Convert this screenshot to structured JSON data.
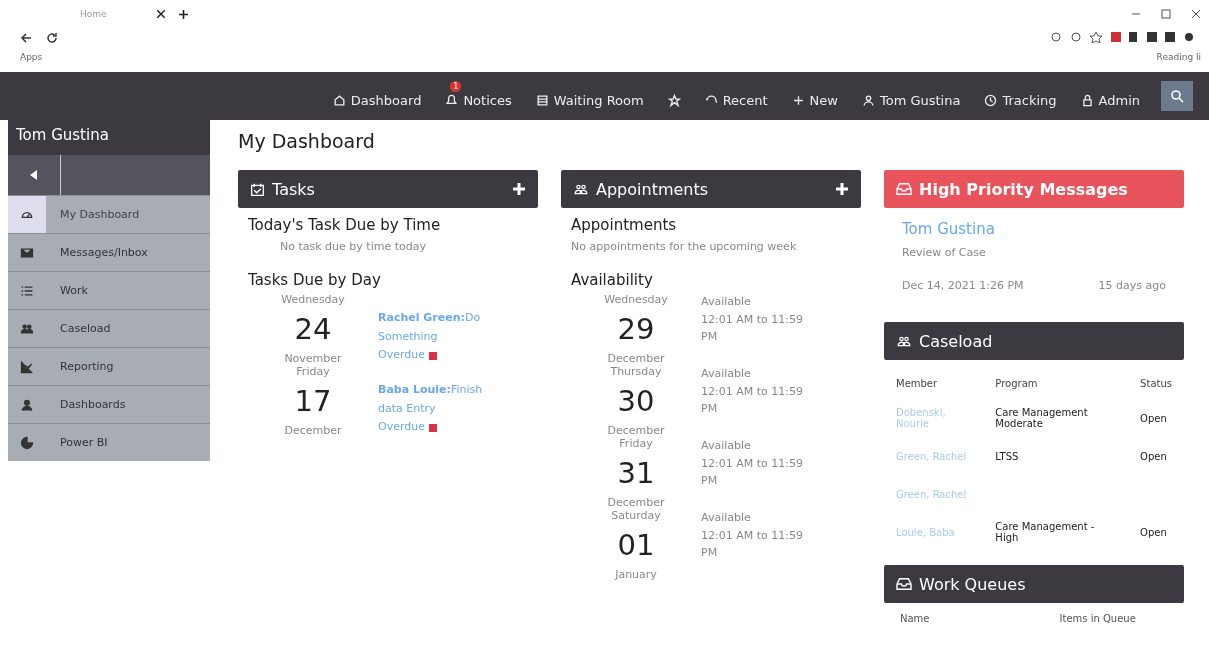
{
  "browser": {
    "tab_title": "Home",
    "bookmark": "Apps",
    "reading_list": "Reading li"
  },
  "topnav": [
    {
      "kind": "home",
      "label": "Dashboard"
    },
    {
      "kind": "bell",
      "label": "Notices",
      "badge": "1"
    },
    {
      "kind": "room",
      "label": "Waiting Room"
    },
    {
      "kind": "star"
    },
    {
      "kind": "recent",
      "label": "Recent"
    },
    {
      "kind": "plus",
      "label": "New"
    },
    {
      "kind": "user",
      "label": "Tom Gustina"
    },
    {
      "kind": "clock",
      "label": "Tracking"
    },
    {
      "kind": "lock",
      "label": "Admin"
    }
  ],
  "sidebar": {
    "user": "Tom Gustina",
    "items": [
      {
        "kind": "gauge",
        "label": "My Dashboard",
        "selected": true
      },
      {
        "kind": "mail",
        "label": "Messages/Inbox",
        "selected": false
      },
      {
        "kind": "list",
        "label": "Work",
        "selected": false
      },
      {
        "kind": "people",
        "label": "Caseload",
        "selected": false
      },
      {
        "kind": "chart",
        "label": "Reporting",
        "selected": false
      },
      {
        "kind": "user",
        "label": "Dashboards",
        "selected": false
      },
      {
        "kind": "pie",
        "label": "Power BI",
        "selected": false
      }
    ]
  },
  "page_title": "My Dashboard",
  "tasks": {
    "title": "Tasks",
    "today_heading": "Today's Task Due by Time",
    "today_empty": "No task due by time today",
    "day_heading": "Tasks Due by Day",
    "days": [
      {
        "weekday": "Wednesday",
        "day": "24",
        "month": "November",
        "who": "Rachel Green:",
        "what": "Do Something",
        "status": "Overdue"
      },
      {
        "weekday": "Friday",
        "day": "17",
        "month": "December",
        "who": "Baba Louie:",
        "what": "Finish data Entry",
        "status": "Overdue"
      }
    ]
  },
  "appointments": {
    "title": "Appointments",
    "heading": "Appointments",
    "empty": "No appointments for the upcoming week",
    "availability_heading": "Availability",
    "days": [
      {
        "weekday": "Wednesday",
        "day": "29",
        "month": "December",
        "status": "Available",
        "time": "12:01 AM to 11:59 PM"
      },
      {
        "weekday": "Thursday",
        "day": "30",
        "month": "December",
        "status": "Available",
        "time": "12:01 AM to 11:59 PM"
      },
      {
        "weekday": "Friday",
        "day": "31",
        "month": "December",
        "status": "Available",
        "time": "12:01 AM to 11:59 PM"
      },
      {
        "weekday": "Saturday",
        "day": "01",
        "month": "January",
        "status": "Available",
        "time": "12:01 AM to 11:59 PM"
      }
    ]
  },
  "messages": {
    "title": "High Priority Messages",
    "from": "Tom Gustina",
    "subject": "Review of Case",
    "date": "Dec 14, 2021 1:26 PM",
    "ago": "15 days ago"
  },
  "caseload": {
    "title": "Caseload",
    "columns": [
      "Member",
      "Program",
      "Status"
    ],
    "rows": [
      {
        "member": "Dobenski, Nourie",
        "program": "Care Management Moderate",
        "status": "Open"
      },
      {
        "member": "Green, Rachel",
        "program": "LTSS",
        "status": "Open"
      },
      {
        "member": "Green, Rachel"
      },
      {
        "member": "Louie, Baba",
        "program": "Care Management - High",
        "status": "Open"
      }
    ]
  },
  "work_queues": {
    "title": "Work Queues",
    "columns": [
      "Name",
      "Items in Queue"
    ]
  }
}
